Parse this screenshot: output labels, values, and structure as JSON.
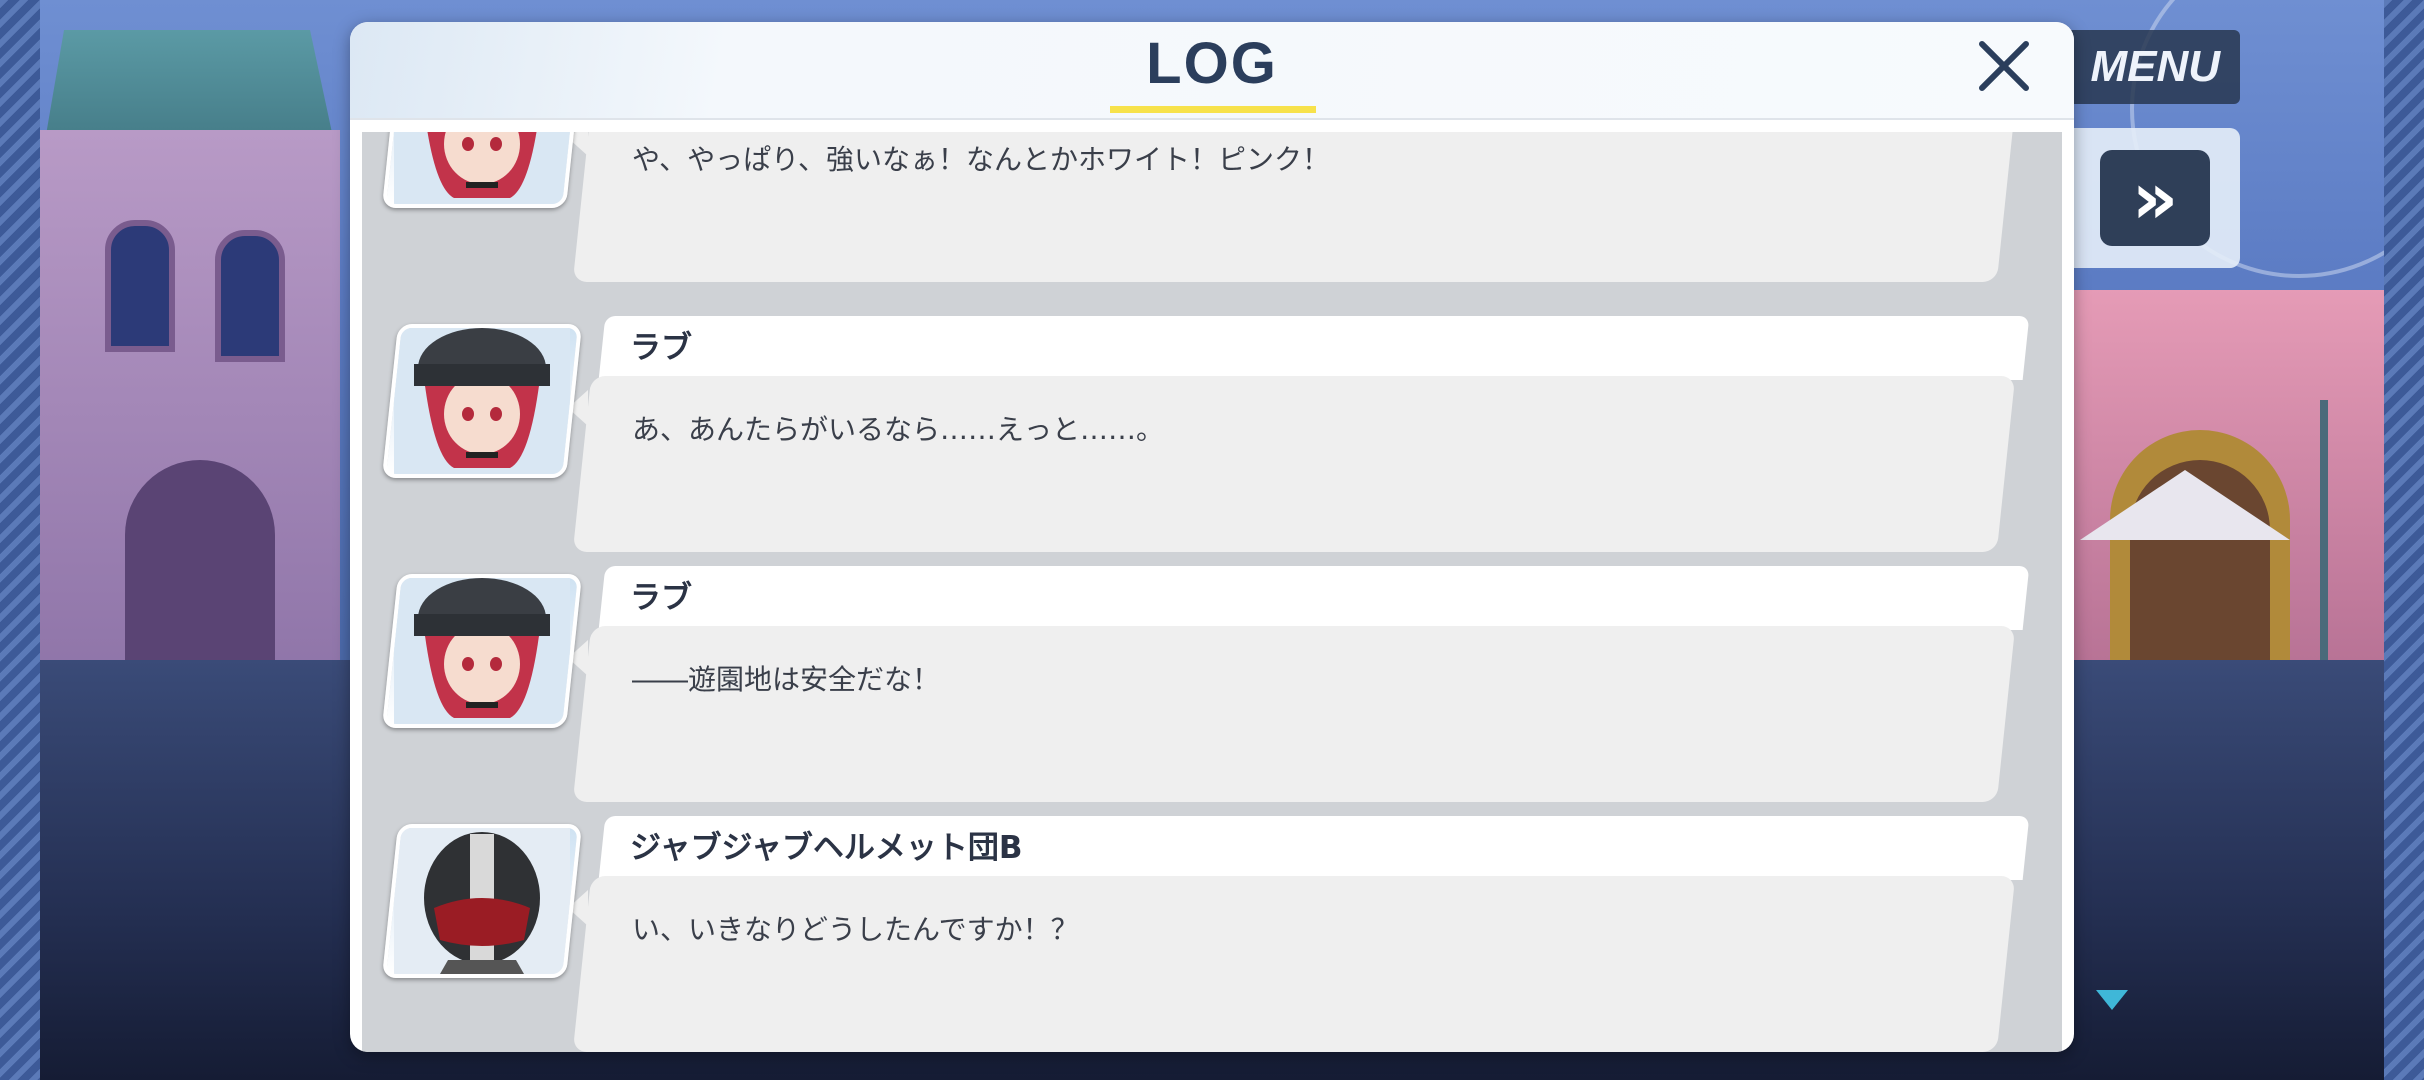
{
  "hud": {
    "menu_label": "MENU",
    "fast_forward_glyph": "»"
  },
  "log": {
    "title": "LOG",
    "close_icon": "close-icon",
    "entries": [
      {
        "speaker": "",
        "text": "や、やっぱり、強いなぁ！なんとかホワイト！ピンク！",
        "portrait": "red-haired-girl-helmet"
      },
      {
        "speaker": "ラブ",
        "text": "あ、あんたらがいるなら……えっと……。",
        "portrait": "red-haired-girl-helmet"
      },
      {
        "speaker": "ラブ",
        "text": "――遊園地は安全だな！",
        "portrait": "red-haired-girl-helmet"
      },
      {
        "speaker": "ジャブジャブヘルメット団B",
        "text": "い、いきなりどうしたんですか！？",
        "portrait": "helmet-grunt"
      }
    ]
  },
  "colors": {
    "title_text": "#2b3e5c",
    "title_underline": "#f7e24b",
    "bubble": "#efefef",
    "log_body": "#cfd2d6"
  }
}
